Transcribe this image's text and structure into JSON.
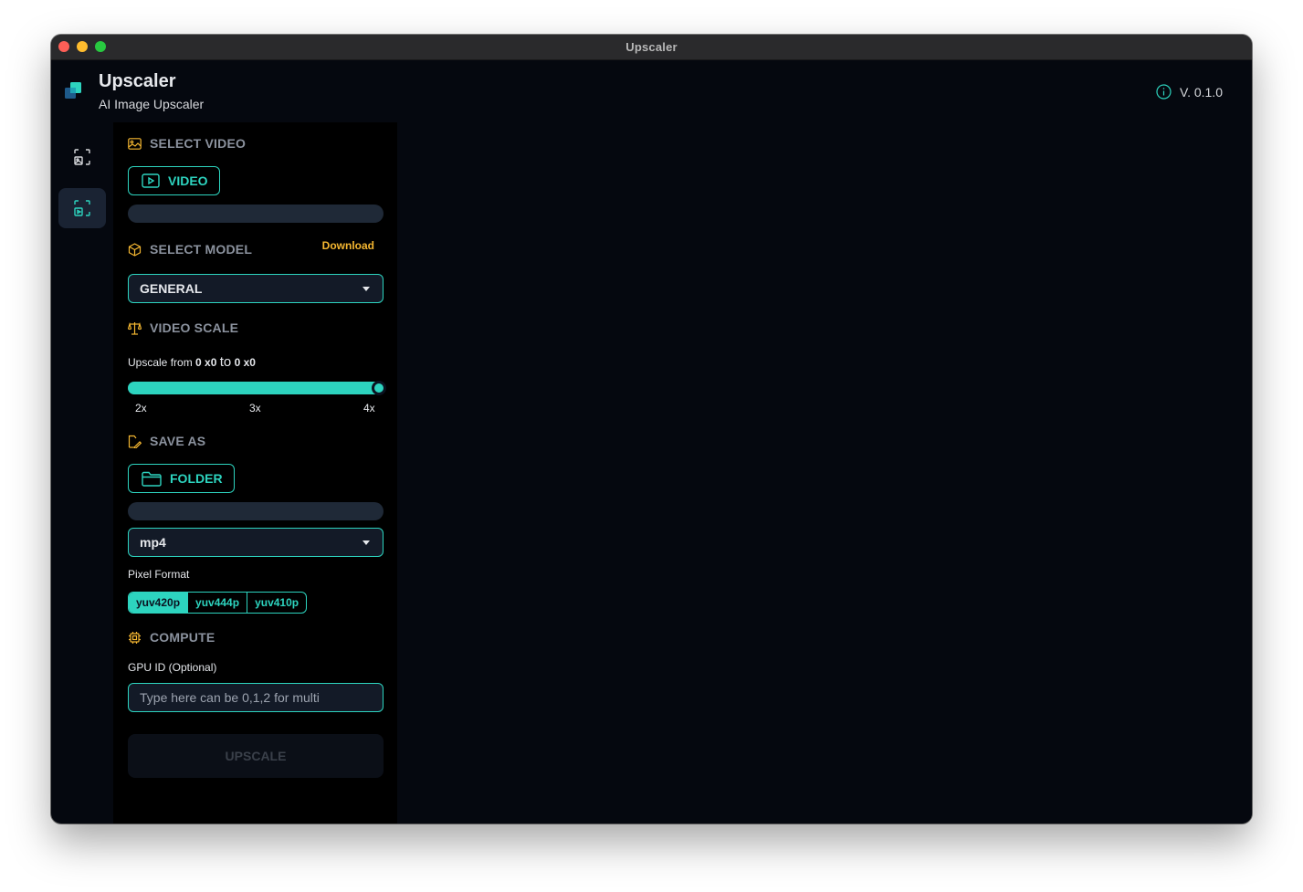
{
  "window": {
    "title": "Upscaler"
  },
  "header": {
    "app_name": "Upscaler",
    "subtitle": "AI Image Upscaler",
    "version": "V. 0.1.0"
  },
  "sidebar": {
    "items": [
      {
        "icon": "image-upscale-icon",
        "active": false
      },
      {
        "icon": "video-upscale-icon",
        "active": true
      }
    ]
  },
  "select_video": {
    "title": "SELECT VIDEO",
    "button_label": "VIDEO"
  },
  "select_model": {
    "title": "SELECT MODEL",
    "download_label": "Download",
    "selected": "GENERAL"
  },
  "video_scale": {
    "title": "VIDEO SCALE",
    "prefix": "Upscale from",
    "from": "0 x0",
    "to_word": "to",
    "to": "0 x0",
    "ticks": [
      "2x",
      "3x",
      "4x"
    ],
    "value": 4,
    "min": 2,
    "max": 4
  },
  "save_as": {
    "title": "SAVE AS",
    "button_label": "FOLDER",
    "format": "mp4"
  },
  "pixel_format": {
    "label": "Pixel Format",
    "options": [
      "yuv420p",
      "yuv444p",
      "yuv410p"
    ],
    "selected": "yuv420p"
  },
  "compute": {
    "title": "COMPUTE",
    "gpu_label": "GPU ID (Optional)",
    "gpu_placeholder": "Type here can be 0,1,2 for multi"
  },
  "upscale_button": "UPSCALE",
  "colors": {
    "accent": "#2dd4bf",
    "warning": "#f5b731",
    "bg": "#05080f",
    "panel": "#000000"
  }
}
